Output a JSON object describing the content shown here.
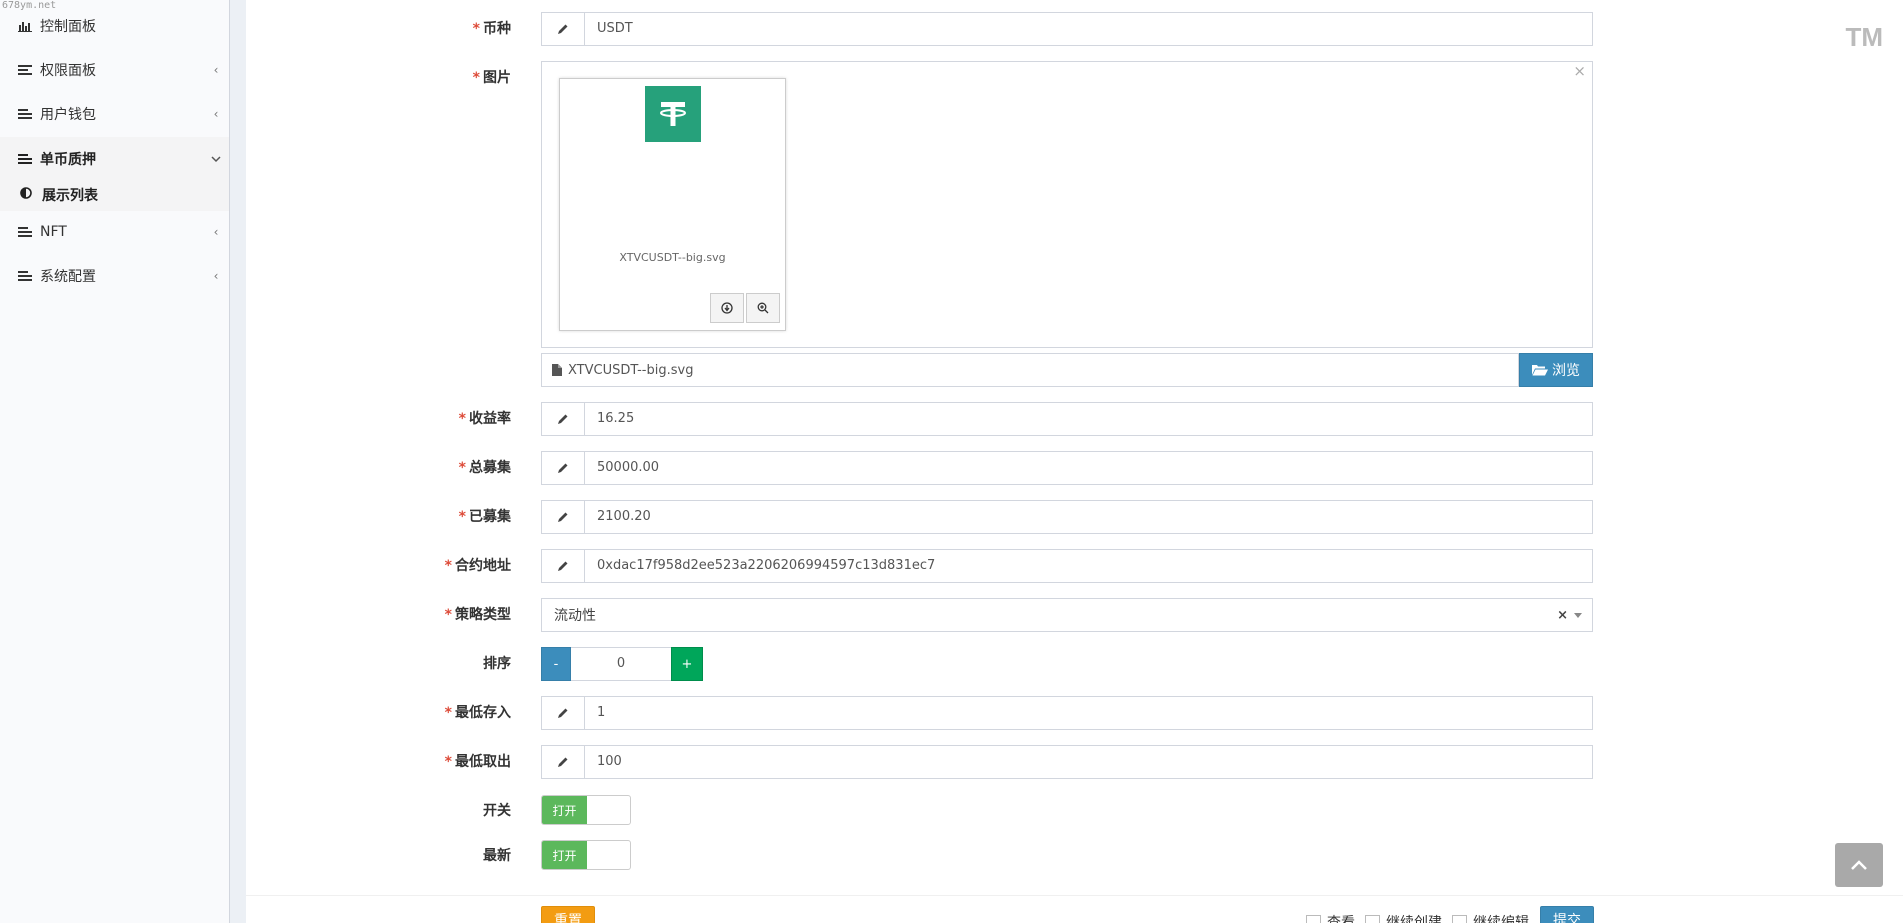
{
  "watermark": "678ym.net",
  "trademark": "TM",
  "sidebar": {
    "items": [
      {
        "label": "控制面板",
        "icon": "bar-chart-icon"
      },
      {
        "label": "权限面板",
        "icon": "list-icon"
      },
      {
        "label": "用户钱包",
        "icon": "list-icon"
      },
      {
        "label": "单币质押",
        "icon": "list-icon"
      },
      {
        "label": "NFT",
        "icon": "list-icon"
      },
      {
        "label": "系统配置",
        "icon": "list-icon"
      }
    ],
    "sub_items": [
      {
        "label": "展示列表",
        "icon": "half-circle-icon"
      }
    ]
  },
  "form": {
    "currency": {
      "label": "币种",
      "value": "USDT"
    },
    "image": {
      "label": "图片",
      "close": "×",
      "file_name": "XTVCUSDT--big.svg",
      "browse_label": "浏览"
    },
    "yield_rate": {
      "label": "收益率",
      "value": "16.25"
    },
    "total_raise": {
      "label": "总募集",
      "value": "50000.00"
    },
    "raised": {
      "label": "已募集",
      "value": "2100.20"
    },
    "contract": {
      "label": "合约地址",
      "value": "0xdac17f958d2ee523a2206206994597c13d831ec7"
    },
    "strategy": {
      "label": "策略类型",
      "value": "流动性",
      "clear": "×"
    },
    "sort": {
      "label": "排序",
      "value": "0",
      "minus": "-",
      "plus": "+"
    },
    "min_deposit": {
      "label": "最低存入",
      "value": "1"
    },
    "min_withdraw": {
      "label": "最低取出",
      "value": "100"
    },
    "switch": {
      "label": "开关",
      "on_label": "打开"
    },
    "latest": {
      "label": "最新",
      "on_label": "打开"
    }
  },
  "footer": {
    "reset": "重置",
    "view": "查看",
    "continue_create": "继续创建",
    "continue_edit": "继续编辑",
    "submit": "提交"
  },
  "colors": {
    "primary": "#3c8dbc",
    "success": "#00a65a",
    "toggle_on": "#5cb85c",
    "warning": "#f39c12",
    "required": "#dd4b39",
    "usdt": "#26a17b"
  }
}
